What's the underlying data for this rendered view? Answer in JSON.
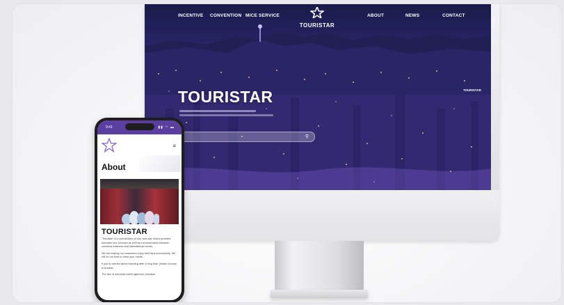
{
  "desktop_site": {
    "nav_left": [
      "INCENTIVE",
      "CONVENTION",
      "MICE SERVICE"
    ],
    "nav_right": [
      "ABOUT",
      "NEWS",
      "CONTACT"
    ],
    "brand_name": "TOURISTAR",
    "hero_title": "TOURISTAR",
    "side_tag": "TOURISTAR"
  },
  "mobile_site": {
    "status_time": "9:41",
    "status_icons": "▮▮ ◠ ▬",
    "about_heading": "About",
    "section_title": "TOURISTAR",
    "paragraphs": [
      "\"Touristar\" is a combination of tour and star, which provides domestic tour services as well as communication between overseas business and international events.",
      "We are helping our customers enjoy their trips successfully. We will do our best to meet your needs.",
      "If you're worried about traveling after a long time, please choose a touristar.",
      "The star of domestic travel agencies, touristar"
    ]
  },
  "colors": {
    "accent_purple": "#5a3fa0",
    "night_sky": "#2d2870"
  }
}
